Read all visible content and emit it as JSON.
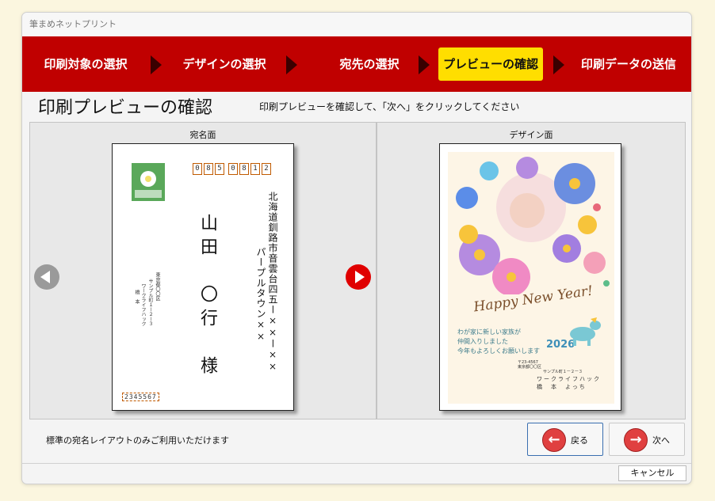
{
  "window": {
    "title": "筆まめネットプリント"
  },
  "steps": [
    {
      "label": "印刷対象の選択",
      "active": false
    },
    {
      "label": "デザインの選択",
      "active": false
    },
    {
      "label": "宛先の選択",
      "active": false
    },
    {
      "label": "プレビューの確認",
      "active": true
    },
    {
      "label": "印刷データの送信",
      "active": false
    }
  ],
  "page": {
    "heading": "印刷プレビューの確認",
    "instruction": "印刷プレビューを確認して、「次へ」をクリックしてください"
  },
  "address_side": {
    "label": "宛名面",
    "postal_code": [
      "0",
      "8",
      "5",
      "0",
      "8",
      "1",
      "2"
    ],
    "recipient_name": "山田　〇行　様",
    "recipient_address": "北海道釧路市音雲台四五ー××ー××",
    "recipient_building": "パープルタウン××",
    "sender_postal": "2345567",
    "sender_lines": [
      "東京都〇〇区",
      "サンプル町１ー２ー３",
      "ワークライフハック",
      "橋　本"
    ]
  },
  "design_side": {
    "label": "デザイン面",
    "greeting": "Happy New Year!",
    "message_lines": [
      "わが家に新しい家族が",
      "仲間入りしました",
      "今年もよろしくお願いします"
    ],
    "year": "2026",
    "sender_postal": "〒23-4567",
    "sender_address_lines": [
      "東京都〇〇区",
      "サンプル町１ー２ー３"
    ],
    "sender_company": "ワークライフハック",
    "sender_name": "橋　本　よっち"
  },
  "footer": {
    "note": "標準の宛名レイアウトのみご利用いただけます",
    "back_label": "戻る",
    "next_label": "次へ",
    "cancel_label": "キャンセル"
  },
  "colors": {
    "step_bar": "#c00000",
    "active_step": "#ffde00",
    "nav_next": "#e00000",
    "nav_prev": "#9a9a9a",
    "postal_box": "#c05a00"
  },
  "icons": {
    "prev": "left-arrow-circle-icon",
    "next": "right-arrow-circle-icon",
    "back": "back-arrow-icon",
    "forward": "forward-arrow-icon"
  }
}
